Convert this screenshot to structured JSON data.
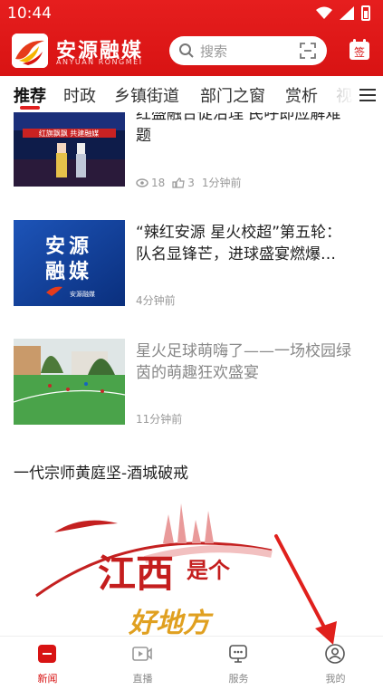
{
  "status": {
    "time": "10:44"
  },
  "header": {
    "logo_title": "安源融媒",
    "logo_sub": "ANYUAN RONGMEI",
    "search_placeholder": "搜索",
    "signin_label": "签"
  },
  "tabs": [
    {
      "label": "推荐",
      "active": true
    },
    {
      "label": "时政"
    },
    {
      "label": "乡镇街道"
    },
    {
      "label": "部门之窗"
    },
    {
      "label": "赏析"
    },
    {
      "label": "视"
    }
  ],
  "news": [
    {
      "title_lines": [
        "红盛融合促治理 民呼即应解难",
        "题"
      ],
      "views": "18",
      "likes": "3",
      "time": "1分钟前",
      "thumb_caption": "红旗飘飘 共建融媒"
    },
    {
      "title_lines": [
        "“辣红安源 星火校超”第五轮：",
        "队名显锋芒，进球盛宴燃爆…"
      ],
      "time": "4分钟前",
      "thumb_text": "安源融媒",
      "thumb_small": "安源融媒"
    },
    {
      "title_lines": [
        "星火足球萌嗨了——一场校园绿",
        "茵的萌趣狂欢盛宴"
      ],
      "time": "11分钟前"
    }
  ],
  "feature": {
    "title": "一代宗师黄庭坚-酒城破戒",
    "banner_text_1": "江西",
    "banner_text_2": "是个",
    "banner_text_3": "好地方"
  },
  "bottom_nav": [
    {
      "label": "新闻",
      "icon": "news-icon",
      "active": true
    },
    {
      "label": "直播",
      "icon": "live-icon"
    },
    {
      "label": "服务",
      "icon": "service-icon"
    },
    {
      "label": "我的",
      "icon": "profile-icon"
    }
  ],
  "colors": {
    "brand": "#d81313",
    "accent": "#e02020"
  }
}
